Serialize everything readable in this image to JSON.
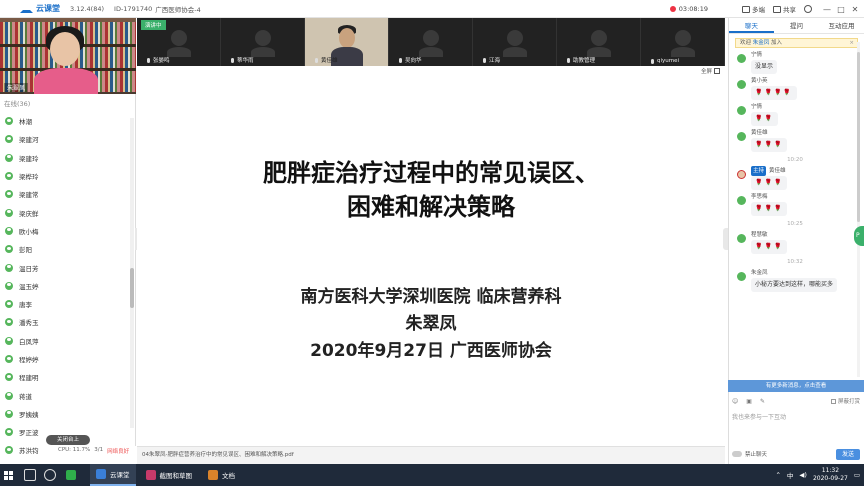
{
  "app": {
    "name": "云课堂",
    "version": "3.12.4(84)",
    "meeting_id": "ID-1791740",
    "meeting_name": "广西医师协会-4"
  },
  "recording_time": "03:08:19",
  "toolbar": {
    "multiscreen": "多端",
    "share": "共享"
  },
  "self_video": {
    "name": "朱翠凤"
  },
  "online_count": "在线(36)",
  "participants": [
    "林潮",
    "梁建河",
    "梁建玲",
    "梁桦玲",
    "梁建常",
    "梁庆鲜",
    "欧小梅",
    "彭阳",
    "温日芳",
    "温玉婷",
    "唐李",
    "潘秀玉",
    "白凤萍",
    "程婷婷",
    "程建明",
    "蒋道",
    "罗姨姨",
    "罗正波",
    "苏洪钧"
  ],
  "close_stage_label": "关闭台上",
  "cpu": {
    "label": "CPU: 11.7%",
    "extra": "3/1",
    "status": "网络良好"
  },
  "video_tag": "演讲中",
  "video_tiles": [
    {
      "name": "张晏鸣",
      "live": false
    },
    {
      "name": "蒂华雨",
      "live": false
    },
    {
      "name": "黄佳雄",
      "live": true
    },
    {
      "name": "吴向华",
      "live": false
    },
    {
      "name": "江海",
      "live": false
    },
    {
      "name": "助教管理",
      "live": false
    },
    {
      "name": "qiyumei",
      "live": false
    }
  ],
  "fullscreen_label": "全屏",
  "slide": {
    "title_lines": [
      "肥胖症治疗过程中的常见误区、",
      "困难和解决策略"
    ],
    "sub_lines": [
      "南方医科大学深圳医院 临床营养科",
      "朱翠凤",
      "2020年9月27日 广西医师协会"
    ]
  },
  "file_name": "04朱翠凤-肥胖症营养治疗中的常见误区、困难和解决策略.pdf",
  "right_tabs": [
    "聊天",
    "提问",
    "互动应用"
  ],
  "welcome": {
    "prefix": "欢迎",
    "name": "朱金凤",
    "suffix": "加入"
  },
  "chat": [
    {
      "type": "msg",
      "name": "宁情",
      "text": "没显示",
      "tag": ""
    },
    {
      "type": "msg",
      "name": "黄小英",
      "text": "🌹🌹🌹🌹",
      "tag": ""
    },
    {
      "type": "msg",
      "name": "宁情",
      "text": "🌹🌹",
      "tag": ""
    },
    {
      "type": "msg",
      "name": "黄佳雄",
      "text": "🌹🌹🌹",
      "tag": ""
    },
    {
      "type": "time",
      "text": "10:20"
    },
    {
      "type": "msg",
      "name": "黄佳雄",
      "text": "🌹🌹🌹",
      "tag": "主持"
    },
    {
      "type": "msg",
      "name": "李思梅",
      "text": "🌹🌹🌹",
      "tag": ""
    },
    {
      "type": "time",
      "text": "10:25"
    },
    {
      "type": "msg",
      "name": "程慧敏",
      "text": "🌹🌹🌹",
      "tag": ""
    },
    {
      "type": "time",
      "text": "10:32"
    },
    {
      "type": "msg",
      "name": "朱金凤",
      "text": "小秘方要达到这样，哪能买多",
      "tag": ""
    }
  ],
  "new_message_bar": "有更多新消息，点击查看",
  "mute_label": "屏蔽打赏",
  "input_placeholder": "我也来参与一下互动",
  "ban_label": "禁止聊天",
  "send_label": "发送",
  "taskbar": {
    "apps": [
      "云课堂",
      "截图和草图",
      "文档"
    ],
    "ime": "中",
    "time": "11:32",
    "date": "2020-09-27"
  }
}
